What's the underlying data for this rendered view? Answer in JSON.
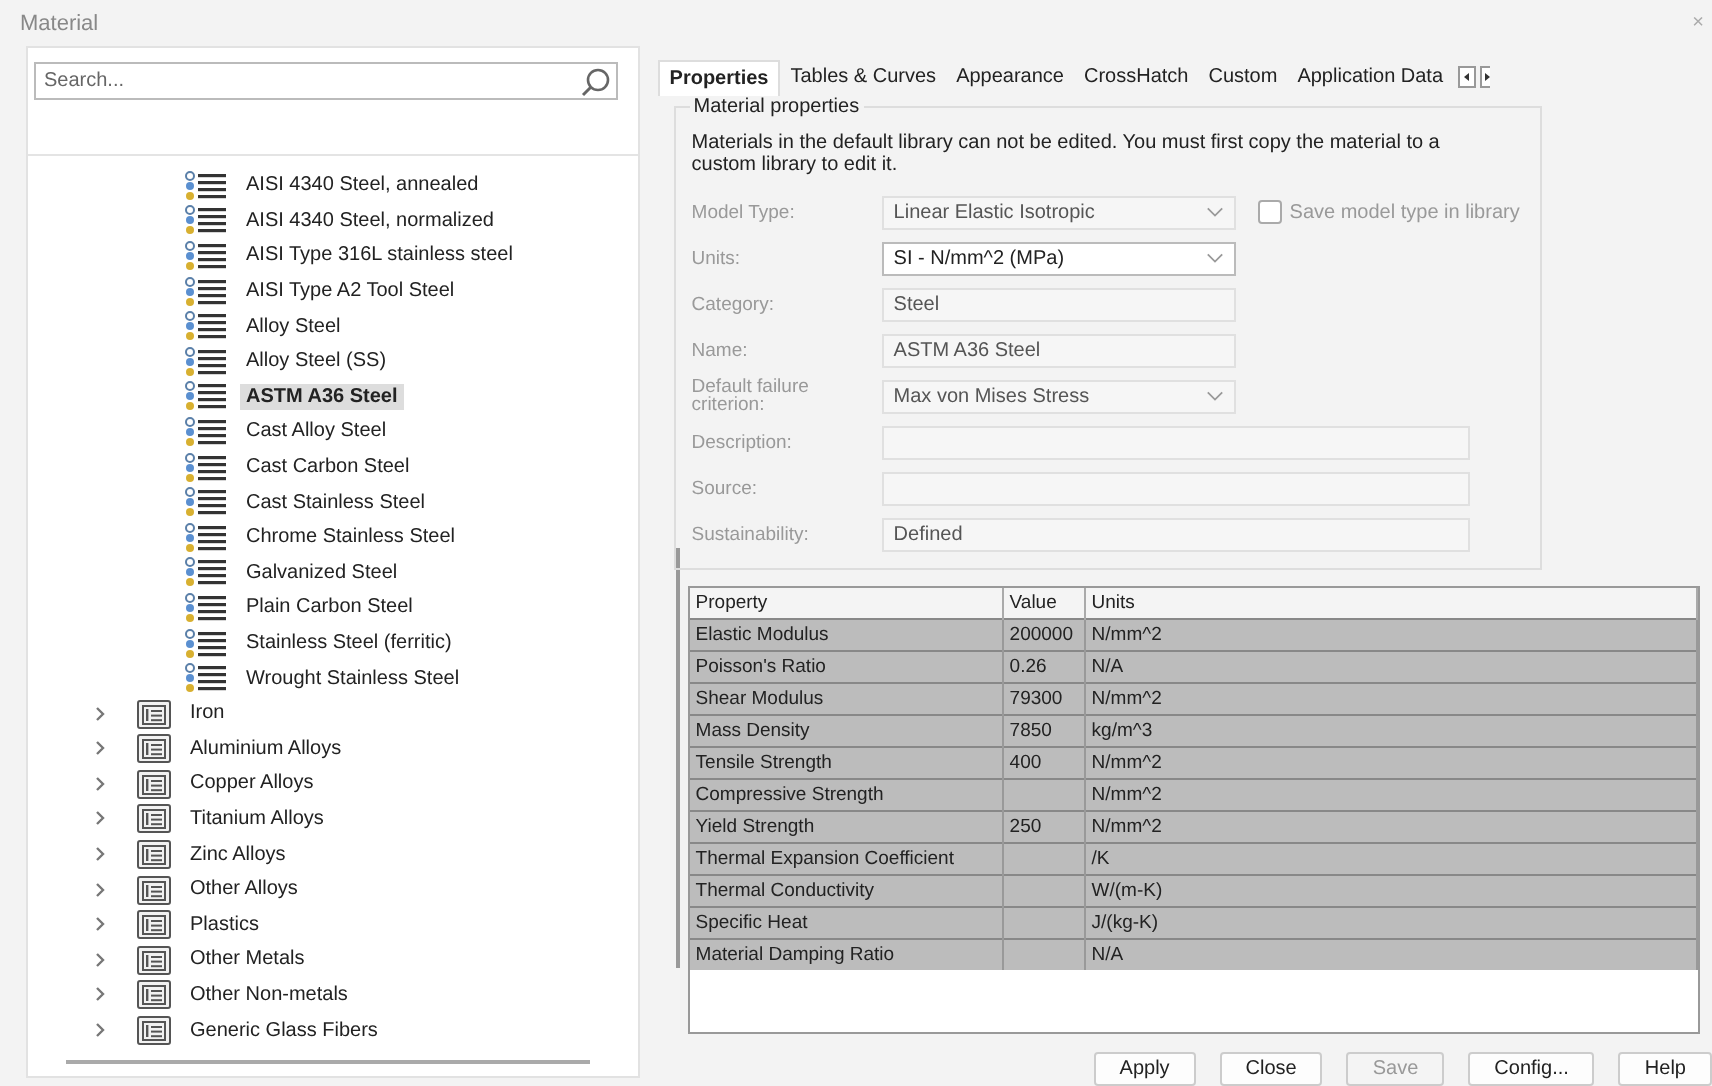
{
  "window": {
    "title": "Material",
    "close": "×"
  },
  "search": {
    "placeholder": "Search..."
  },
  "tree": [
    {
      "kind": "material",
      "label": "AISI 4340 Steel, annealed",
      "selected": false
    },
    {
      "kind": "material",
      "label": "AISI 4340 Steel, normalized",
      "selected": false
    },
    {
      "kind": "material",
      "label": "AISI Type 316L stainless steel",
      "selected": false
    },
    {
      "kind": "material",
      "label": "AISI Type A2 Tool Steel",
      "selected": false
    },
    {
      "kind": "material",
      "label": "Alloy Steel",
      "selected": false
    },
    {
      "kind": "material",
      "label": "Alloy Steel (SS)",
      "selected": false
    },
    {
      "kind": "material",
      "label": "ASTM A36 Steel",
      "selected": true
    },
    {
      "kind": "material",
      "label": "Cast Alloy Steel",
      "selected": false
    },
    {
      "kind": "material",
      "label": "Cast Carbon Steel",
      "selected": false
    },
    {
      "kind": "material",
      "label": "Cast Stainless Steel",
      "selected": false
    },
    {
      "kind": "material",
      "label": "Chrome Stainless Steel",
      "selected": false
    },
    {
      "kind": "material",
      "label": "Galvanized Steel",
      "selected": false
    },
    {
      "kind": "material",
      "label": "Plain Carbon Steel",
      "selected": false
    },
    {
      "kind": "material",
      "label": "Stainless Steel (ferritic)",
      "selected": false
    },
    {
      "kind": "material",
      "label": "Wrought Stainless Steel",
      "selected": false
    },
    {
      "kind": "folder",
      "label": "Iron",
      "expanded": false
    },
    {
      "kind": "folder",
      "label": "Aluminium Alloys",
      "expanded": false
    },
    {
      "kind": "folder",
      "label": "Copper Alloys",
      "expanded": false
    },
    {
      "kind": "folder",
      "label": "Titanium Alloys",
      "expanded": false
    },
    {
      "kind": "folder",
      "label": "Zinc Alloys",
      "expanded": false
    },
    {
      "kind": "folder",
      "label": "Other Alloys",
      "expanded": false
    },
    {
      "kind": "folder",
      "label": "Plastics",
      "expanded": false
    },
    {
      "kind": "folder",
      "label": "Other Metals",
      "expanded": false
    },
    {
      "kind": "folder",
      "label": "Other Non-metals",
      "expanded": false
    },
    {
      "kind": "folder",
      "label": "Generic Glass Fibers",
      "expanded": false
    }
  ],
  "tabs": [
    {
      "label": "Properties",
      "selected": true
    },
    {
      "label": "Tables & Curves",
      "selected": false
    },
    {
      "label": "Appearance",
      "selected": false
    },
    {
      "label": "CrossHatch",
      "selected": false
    },
    {
      "label": "Custom",
      "selected": false
    },
    {
      "label": "Application Data",
      "selected": false
    }
  ],
  "group": {
    "title": "Material properties",
    "notice": "Materials in the default library can not be edited. You must first copy the material to a custom library to edit it."
  },
  "fields": [
    {
      "kind": "dropdown",
      "label": "Model Type:",
      "value": "Linear Elastic Isotropic",
      "disabled": true,
      "wide": false
    },
    {
      "kind": "dropdown",
      "label": "Units:",
      "value": "SI - N/mm^2 (MPa)",
      "disabled": false,
      "wide": false
    },
    {
      "kind": "text",
      "label": "Category:",
      "value": "Steel",
      "disabled": true,
      "wide": false
    },
    {
      "kind": "text",
      "label": "Name:",
      "value": "ASTM A36 Steel",
      "disabled": true,
      "wide": false
    },
    {
      "kind": "dropdown",
      "label": "Default failure criterion:",
      "value": "Max von Mises Stress",
      "disabled": true,
      "wide": false
    },
    {
      "kind": "text",
      "label": "Description:",
      "disabled": true,
      "wide": true
    },
    {
      "kind": "text",
      "label": "Source:",
      "disabled": true,
      "wide": true
    },
    {
      "kind": "text",
      "label": "Sustainability:",
      "value": "Defined",
      "disabled": true,
      "wide": true
    }
  ],
  "save_model_type": {
    "label": "Save model type in library",
    "checked": false,
    "disabled": true
  },
  "table": {
    "columns": [
      "Property",
      "Value",
      "Units"
    ],
    "rows": [
      [
        "Elastic Modulus",
        "200000",
        "N/mm^2"
      ],
      [
        "Poisson's Ratio",
        "0.26",
        "N/A"
      ],
      [
        "Shear Modulus",
        "79300",
        "N/mm^2"
      ],
      [
        "Mass Density",
        "7850",
        "kg/m^3"
      ],
      [
        "Tensile Strength",
        "400",
        "N/mm^2"
      ],
      [
        "Compressive Strength",
        "",
        "N/mm^2"
      ],
      [
        "Yield Strength",
        "250",
        "N/mm^2"
      ],
      [
        "Thermal Expansion Coefficient",
        "",
        "/K"
      ],
      [
        "Thermal Conductivity",
        "",
        "W/(m-K)"
      ],
      [
        "Specific Heat",
        "",
        "J/(kg-K)"
      ],
      [
        "Material Damping Ratio",
        "",
        "N/A"
      ]
    ]
  },
  "buttons": [
    {
      "label": "Apply",
      "disabled": false
    },
    {
      "label": "Close",
      "disabled": false
    },
    {
      "label": "Save",
      "disabled": true
    },
    {
      "label": "Config...",
      "disabled": false
    },
    {
      "label": "Help",
      "disabled": false
    }
  ]
}
